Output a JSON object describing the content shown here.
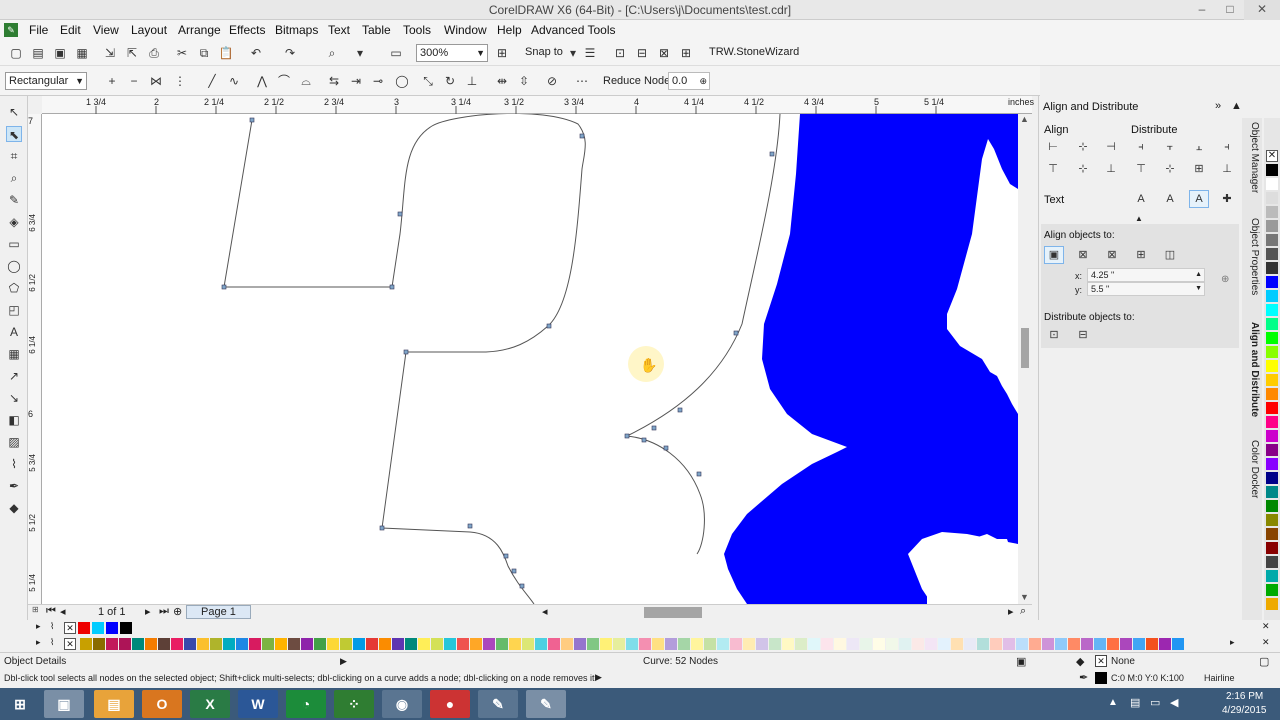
{
  "window": {
    "title": "CorelDRAW X6 (64-Bit) - [C:\\Users\\j\\Documents\\test.cdr]",
    "minimize": "–",
    "maximize": "□",
    "close": "✕"
  },
  "menu": [
    "File",
    "Edit",
    "View",
    "Layout",
    "Arrange",
    "Effects",
    "Bitmaps",
    "Text",
    "Table",
    "Tools",
    "Window",
    "Help",
    "Advanced Tools"
  ],
  "toolbar": {
    "zoom_value": "300%",
    "snap_to": "Snap to",
    "plugin_label": "TRW.StoneWizard"
  },
  "property_bar": {
    "selection_mode": "Rectangular",
    "reduce_nodes_label": "Reduce Nodes",
    "reduce_nodes_value": "0.0"
  },
  "ruler": {
    "h_labels": [
      "1 3/4",
      "2",
      "2 1/4",
      "2 1/2",
      "2 3/4",
      "3",
      "3 1/4",
      "3 1/2",
      "3 3/4",
      "4",
      "4 1/4",
      "4 1/2",
      "4 3/4",
      "5",
      "5 1/4"
    ],
    "unit": "inches",
    "v_labels": [
      "7",
      "6 3/4",
      "6 1/2",
      "6 1/4",
      "6",
      "5 3/4",
      "5 1/2",
      "5 1/4"
    ]
  },
  "pagebar": {
    "page_count": "1 of 1",
    "page_tab": "Page 1"
  },
  "docker": {
    "title": "Align and Distribute",
    "align_label": "Align",
    "distribute_label": "Distribute",
    "text_label": "Text",
    "align_objects_to": "Align objects to:",
    "x_label": "x:",
    "x_value": "4.25 \"",
    "y_label": "y:",
    "y_value": "5.5 \"",
    "distribute_objects_to": "Distribute objects to:",
    "tabs": [
      "Object Manager",
      "Object Properties",
      "Align and Distribute",
      "Color Docker"
    ]
  },
  "status": {
    "object_details": "Object Details",
    "curve_info": "Curve: 52 Nodes",
    "hint": "Dbl-click tool selects all nodes on the selected object; Shift+click multi-selects; dbl-clicking on a curve adds a node; dbl-clicking on a node removes it",
    "fill": "None",
    "outline": "C:0 M:0 Y:0 K:100",
    "outline_width": "Hairline"
  },
  "taskbar": {
    "time": "2:16 PM",
    "date": "4/29/2015"
  },
  "colors": {
    "shape_fill": "#0000ff",
    "curve_stroke": "#555555",
    "taskbar": "#3b5a7a"
  }
}
